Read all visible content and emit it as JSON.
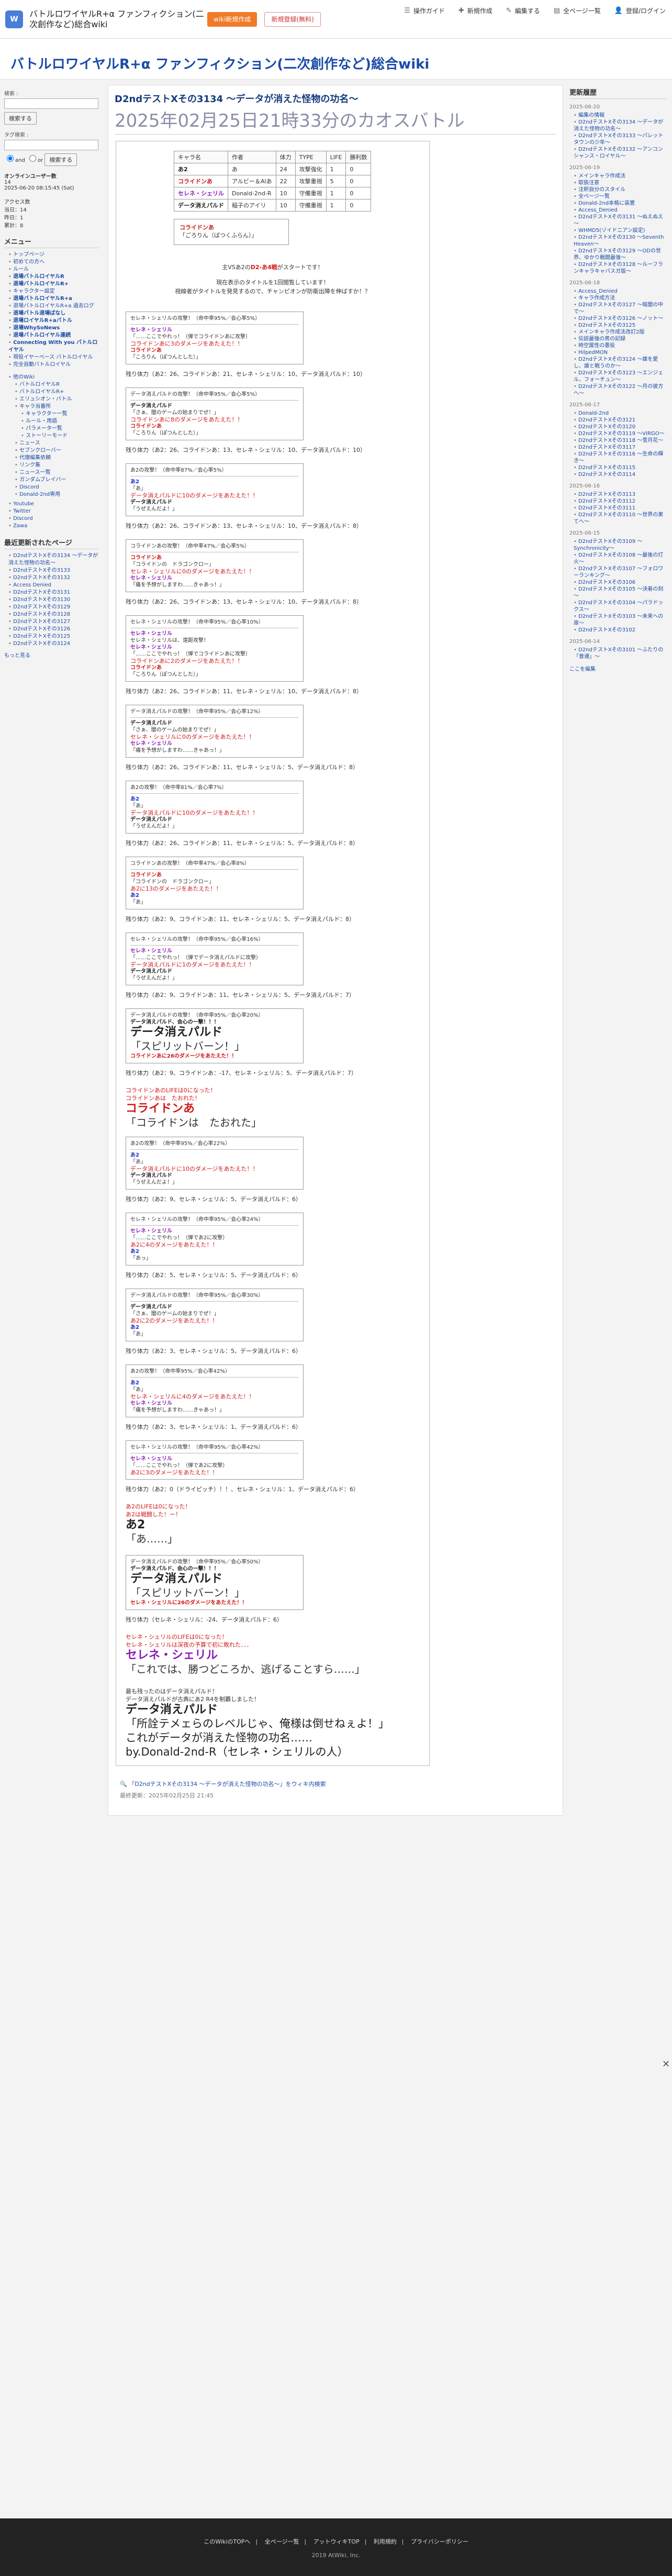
{
  "header": {
    "logo": "W",
    "site_name": "バトルロワイヤルR+α ファンフィクション(二次創作など)総合wiki",
    "btn_new": "wiki新規作成",
    "btn_login": "新規登録(無料)",
    "nav": [
      "操作ガイド",
      "新規作成",
      "編集する",
      "全ページ一覧",
      "登録/ログイン"
    ]
  },
  "site_title": "バトルロワイヤルR+α ファンフィクション(二次創作など)総合wiki",
  "left": {
    "search_label": "検索 :",
    "search_button": "検索する",
    "tag_label": "タグ検索 :",
    "tag_button": "検索する",
    "and_label": "and",
    "or_label": "or",
    "online_title": "オンラインユーザー数",
    "online_count": "14",
    "time": "2025-06-20 08:15:45 (Sat)",
    "access_title": "アクセス数",
    "access_today": "当日：14",
    "access_yesterday": "昨日：1",
    "access_total": "累計：8",
    "menu_title": "メニュー",
    "menu_items": [
      "トップページ",
      "初めての方へ",
      "ルール",
      "退場バトルロイヤルR",
      "退場バトルロイヤルR+",
      "キャラクター設定",
      "退場バトルロイヤルR+a",
      "退場バトルロイヤルR+a 過去ログ",
      "退場バトル退場ばなし",
      "退場ロイヤルR+aバトル",
      "退場WhySoNews",
      "退場バトルロイヤル連続",
      "Connecting With you バトルロイヤル",
      "現役イヤーベース バトルロイヤル",
      "完全自動バトルロイヤル"
    ],
    "submenu_items": [
      "他のWiki",
      "バトルロイヤルR",
      "バトルロイヤルR+",
      "エリュシオン・バトル",
      "キャラ当番所",
      "キャラクター一覧",
      "ルール・用語",
      "パラメータ一覧",
      "ストーリーモード",
      "ニュース",
      "セブンクローバー",
      "代理編集依頼",
      "リンク集",
      "ニュース一覧",
      "ガンダムブレイバー",
      "Discord",
      "Donald-2nd専用"
    ],
    "misc_items": [
      "Youtube",
      "Twitter",
      "Discord",
      "Zawa"
    ],
    "recent_title": "最近更新されたページ",
    "recent_items": [
      "D2ndテストXその3134 ～データが消えた怪物の功名～",
      "D2ndテストXその3133",
      "D2ndテストXその3132",
      "Access Denied",
      "D2ndテストXその3131",
      "D2ndテストXその3130",
      "D2ndテストXその3129",
      "D2ndテストXその3128",
      "D2ndテストXその3127",
      "D2ndテストXその3126",
      "D2ndテストXその3125",
      "D2ndテストXその3124"
    ],
    "more": "もっと見る"
  },
  "main": {
    "subtitle": "D2ndテストXその3134 ～データが消えた怪物の功名～",
    "title": "2025年02月25日21時33分のカオスバトル",
    "stats_headers": [
      "キャラ名",
      "作者",
      "体力",
      "TYPE",
      "LIFE",
      "勝利数"
    ],
    "stats_rows": [
      [
        "あ2",
        "あ",
        "24",
        "攻撃強化",
        "1",
        "0"
      ],
      [
        "コライドンあ",
        "アルビー＆AIあ",
        "22",
        "攻撃重視",
        "5",
        "0"
      ],
      [
        "セレネ・シェリル",
        "Donald-2nd-R",
        "10",
        "守備重視",
        "1",
        "0"
      ],
      [
        "データ消えパルド",
        "稲子のアイリ",
        "10",
        "守備重視",
        "1",
        "0"
      ]
    ],
    "party_intro_name": "コライドンあ",
    "party_intro_text": "「ごろりん（ばつくふらん）」",
    "intro_line1_pre": "主VSあ2の",
    "intro_line1_name": "D2-あ4戦",
    "intro_line1_post": "がスタートです！",
    "intro_line2": "現在表示のタイトルを1回閲覧しています！",
    "intro_line3": "視線者がタイトルを発見するので、チャンピオンが防衛出陣を伸ばすか！？",
    "turns": [
      {
        "attacker": "セレネ・シェリル",
        "text": "セレネ・シェリルの攻撃！（命中率95%／会心率5%）",
        "lines": [
          "セレネ・シェリル",
          "「……ここでやれっ！（弾でコライドンあに攻撃）",
          "コライドンあに3のダメージをあたえた！！",
          "コライドンあ",
          "「ころりん（ぽつんとした）」"
        ],
        "hp": "残り体力（あ2：26、コライドンあ：21、セレネ・シェリル：10、データ消えパルド：10）"
      },
      {
        "attacker": "データ消えパルド",
        "text": "データ消えパルドの攻撃！（命中率95%／会心率5%）",
        "lines": [
          "データ消えパルド",
          "「さぁ、闇のゲームの始まりでぜ！」",
          "コライドンあに8のダメージをあたえた！！",
          "コライドンあ",
          "「ころりん（ぽつんとした）」"
        ],
        "hp": "残り体力（あ2：26、コライドンあ：13、セレネ・シェリル：10、データ消えパルド：10）"
      },
      {
        "attacker": "あ2",
        "text": "あ2の攻撃！（命中率87%／会心率5%）",
        "lines": [
          "あ2",
          "「あ」",
          "データ消えパルドに10のダメージをあたえた！！",
          "データ消えパルド",
          "「うぜえんだよ！」"
        ],
        "hp": "残り体力（あ2：26、コライドンあ：13、セレネ・シェリル：10、データ消えパルド：8）"
      },
      {
        "attacker": "コライドンあ",
        "text": "コライドンあの攻撃！（命中率47%／会心率5%）",
        "lines": [
          "コライドンあ",
          "「コライドンの　ドラゴンクロー」",
          "セレネ・シェリルに0のダメージをあたえた！！",
          "セレネ・シェリル",
          "「痛を予想がしますわ……きゃあっ！」"
        ],
        "hp": "残り体力（あ2：26、コライドンあ：13、セレネ・シェリル：10、データ消えパルド：8）"
      },
      {
        "attacker": "セレネ・シェリル",
        "text": "セレネ・シェリルの攻撃！（命中率95%／会心率10%）",
        "lines": [
          "セレネ・シェリル",
          "セレネ・シェリルは、遠距攻撃！",
          "セレネ・シェリル",
          "「……ここでやれっ！（弾でコライドンあに攻撃）",
          "コライドンあに2のダメージをあたえた！！",
          "コライドンあ",
          "「ころりん（ぽつんとした）」"
        ],
        "hp": "残り体力（あ2：26、コライドンあ：11、セレネ・シェリル：10、データ消えパルド：8）"
      },
      {
        "attacker": "データ消えパルド",
        "text": "データ消えパルドの攻撃！（命中率95%／会心率12%）",
        "lines": [
          "データ消えパルド",
          "「さぁ、闇のゲームの始まりでぜ！」",
          "セレネ・シェリルに0のダメージをあたえた！！",
          "セレネ・シェリル",
          "「痛を予想がしますわ……きゃあっ！」"
        ],
        "hp": "残り体力（あ2：26、コライドンあ：11、セレネ・シェリル：5、データ消えパルド：8）"
      },
      {
        "attacker": "あ2",
        "text": "あ2の攻撃！（命中率81%／会心率7%）",
        "lines": [
          "あ2",
          "「あ」",
          "データ消えパルドに10のダメージをあたえた！！",
          "データ消えパルド",
          "「うぜえんだよ！」"
        ],
        "hp": "残り体力（あ2：26、コライドンあ：11、セレネ・シェリル：5、データ消えパルド：8）"
      },
      {
        "attacker": "コライドンあ",
        "text": "コライドンあの攻撃！（命中率47%／会心率8%）",
        "lines": [
          "コライドンあ",
          "「コライドンの　ドラゴンクロー」",
          "あ2に13のダメージをあたえた！！",
          "あ2",
          "「あ」"
        ],
        "hp": "残り体力（あ2：9、コライドンあ：11、セレネ・シェリル：5、データ消えパルド：8）"
      },
      {
        "attacker": "セレネ・シェリル",
        "text": "セレネ・シェリルの攻撃！（命中率95%／会心率16%）",
        "lines": [
          "セレネ・シェリル",
          "「……ここでやれっ！（弾でデータ消えパルドに攻撃）",
          "データ消えパルドに1のダメージをあたえた！！",
          "データ消えパルド",
          "「うぜえんだよ！」"
        ],
        "hp": "残り体力（あ2：9、コライドンあ：11、セレネ・シェリル：5、データ消えパルド：7）"
      }
    ],
    "special_attack": {
      "text": "データ消えパルドの攻撃！（命中率95%／会心率20%）",
      "crit": "データ消えパルド、会心の一撃！！！",
      "big_name": "データ消えパルド",
      "big_line": "「スピリットバーン！」",
      "damage": "コライドンあに26のダメージをあたえた！！",
      "hp": "残り体力（あ2：9、コライドンあ：-17、セレネ・シェリル：5、データ消えパルド：7）"
    },
    "ko1": {
      "line1": "コライドンあのLIFEは0になった！",
      "line2": "コライドンあは　たおれた！",
      "big_name": "コライドンあ",
      "big_line": "「コライドンは　たおれた」"
    },
    "turns2": [
      {
        "text": "あ2の攻撃！（命中率95%／会心率22%）",
        "lines": [
          "あ2",
          "「あ」",
          "データ消えパルドに10のダメージをあたえた！！",
          "データ消えパルド",
          "「うぜえんだよ！」"
        ],
        "hp": "残り体力（あ2：9、セレネ・シェリル：5、データ消えパルド：6）"
      },
      {
        "text": "セレネ・シェリルの攻撃！（命中率95%／会心率24%）",
        "lines": [
          "セレネ・シェリル",
          "「……ここでやれっ！（弾であ2に攻撃）",
          "あ2に4のダメージをあたえた！！",
          "あ2",
          "「あっ」"
        ],
        "hp": "残り体力（あ2：5、セレネ・シェリル：5、データ消えパルド：6）"
      },
      {
        "text": "データ消えパルドの攻撃！（命中率95%／会心率30%）",
        "lines": [
          "データ消えパルド",
          "「さぁ、闇のゲームの始まりでぜ！」",
          "あ2に2のダメージをあたえた！！",
          "あ2",
          "「あ」"
        ],
        "hp": "残り体力（あ2：3、セレネ・シェリル：5、データ消えパルド：6）"
      },
      {
        "text": "あ2の攻撃！（命中率95%／会心率42%）",
        "lines": [
          "あ2",
          "「あ」",
          "セレネ・シェリルに4のダメージをあたえた！！",
          "セレネ・シェリル",
          "「痛を予想がしますわ……きゃあっ！」"
        ],
        "hp": "残り体力（あ2：3、セレネ・シェリル：1、データ消えパルド：6）"
      },
      {
        "text": "セレネ・シェリルの攻撃！（命中率95%／会心率42%）",
        "lines": [
          "セレネ・シェリル",
          "「……ここでやれっ！（弾であ2に攻撃）",
          "あ2に3のダメージをあたえた！！"
        ],
        "hp": "残り体力（あ2：0（ドライピッチ）！！、セレネ・シェリル：1、データ消えパルド：6）"
      }
    ],
    "ko2": {
      "line1": "あ2のLIFEは0になった！",
      "line2": "あ2は戦闘した！ー！",
      "big_name": "あ2",
      "big_line": "「あ……」"
    },
    "special_attack2": {
      "text": "データ消えパルドの攻撃！（命中率95%／会心率50%）",
      "crit": "データ消えパルド、会心の一撃！！！",
      "big_name": "データ消えパルド",
      "big_line": "「スピリットバーン！」",
      "damage": "セレネ・シェリルに26のダメージをあたえた！！",
      "hp": "残り体力（セレネ・シェリル：-24、データ消えパルド：6）"
    },
    "ko3": {
      "line1": "セレネ・シェリルのLIFEは0になった！",
      "line2": "セレネ・シェリルは深夜の予算で初に敗れた．．．",
      "big_name": "セレネ・シェリル",
      "big_line": "「これでは、勝つどころか、逃げることすら……」"
    },
    "finale": {
      "line1": "最も残ったのはデータ消えパルド！",
      "line2": "データ消えパルドが古典にあ2 R4を制覇しました！",
      "big_name": "データ消えパルド",
      "big_line1": "「所詮テメェらのレベルじゃ、俺様は倒せねぇよ！」",
      "big_line2": "これがデータが消えた怪物の功名……",
      "big_line3": "by.Donald-2nd-R（セレネ・シェリルの人）"
    },
    "bottom_link": "「D2ndテストXその3134 ～データが消えた怪物の功名～」をウィキ内検索",
    "updated": "最終更新：2025年02月25日 21:45"
  },
  "right": {
    "title": "更新履歴",
    "groups": [
      {
        "date": "2025-06-20",
        "items": [
          "編集の情報",
          "D2ndテストXその3134 ～データが消えた怪物の功名～",
          "D2ndテストXその3133 ～パレットタウンの少年～",
          "D2ndテストXその3132 ～アンコンシャンス・ロイヤル～"
        ]
      },
      {
        "date": "2025-06-19",
        "items": [
          "メインキャラ作成法",
          "取扱注意",
          "注釈自分のスタイル",
          "全ページ一覧",
          "Donald-2nd本格に装置",
          "Access_Denied",
          "D2ndテストXその3131 ～ぬえぬえ～",
          "WHMD5(ゾイドニアン設定)",
          "D2ndテストXその3130 ～Seventh Heaven～",
          "D2ndテストXその3129 ～ODの世界、ゆかり戦闘最強～",
          "D2ndテストXその3128 ～ルーフランキャラキャバスガ版～"
        ]
      },
      {
        "date": "2025-06-18",
        "items": [
          "Access_Denied",
          "キャラ作成方法",
          "D2ndテストXその3127 ～暗闇の中で～",
          "D2ndテストXその3126 ～ノット～",
          "D2ndテストXその3125",
          "メインキャラ作成法改訂2版",
          "伝説最強の男の記録",
          "時空属性の悪役",
          "HilpedMON",
          "D2ndテストXその3124 ～誰を愛し、誰と戦うのか～",
          "D2ndテストXその3123 ～エンジェル、フォーチュン～",
          "D2ndテストXその3122 ～月の彼方へ～"
        ]
      },
      {
        "date": "2025-06-17",
        "items": [
          "Donald-2nd",
          "D2ndテストXその3121",
          "D2ndテストXその3120",
          "D2ndテストXその3119 ～VIRGO～",
          "D2ndテストXその3118 ～雪月花～",
          "D2ndテストXその3117",
          "D2ndテストXその3116 ～生命の輝き～",
          "D2ndテストXその3115",
          "D2ndテストXその3114"
        ]
      },
      {
        "date": "2025-06-16",
        "items": [
          "D2ndテストXその3113",
          "D2ndテストXその3112",
          "D2ndテストXその3111",
          "D2ndテストXその3110 ～世界の果てへ～"
        ]
      },
      {
        "date": "2025-06-15",
        "items": [
          "D2ndテストXその3109 ～Synchronicity～",
          "D2ndテストXその3108 ～最後の灯火～",
          "D2ndテストXその3107 ～フォロワーランキング～",
          "D2ndテストXその3106",
          "D2ndテストXその3105 ～決着の刻～",
          "D2ndテストXその3104 ～パラドックス～",
          "D2ndテストXその3103 ～未来への扉～",
          "D2ndテストXその3102"
        ]
      },
      {
        "date": "2025-06-14",
        "items": [
          "D2ndテストXその3101 ～ふたりの「普通」～"
        ]
      }
    ],
    "more": "ここを編集"
  },
  "footer": {
    "links": [
      "このWikiのTOPへ",
      "全ページ一覧",
      "アットウィキTOP",
      "利用規約",
      "プライバシーポリシー"
    ],
    "copy": "2019 AtWiki, Inc."
  }
}
